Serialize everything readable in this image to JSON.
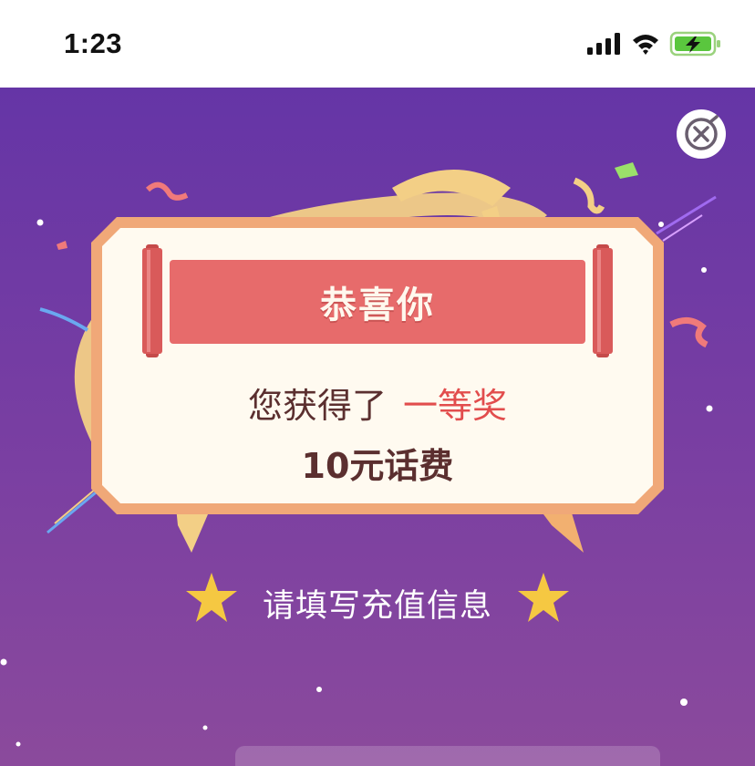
{
  "status_bar": {
    "time": "1:23"
  },
  "close_button": {
    "icon": "close-circle-icon"
  },
  "prize": {
    "title": "恭喜你",
    "received_label": "您获得了",
    "level": "一等奖",
    "amount": "10元话费"
  },
  "prompt": {
    "fill_info": "请填写充值信息"
  },
  "colors": {
    "stage_top": "#6535a6",
    "card_border": "#f0a878",
    "card_bg": "#fffaf0",
    "banner": "#e76b6b",
    "prize_text": "#5b2f2f",
    "prize_level": "#e24d4d",
    "star": "#f5c842"
  }
}
